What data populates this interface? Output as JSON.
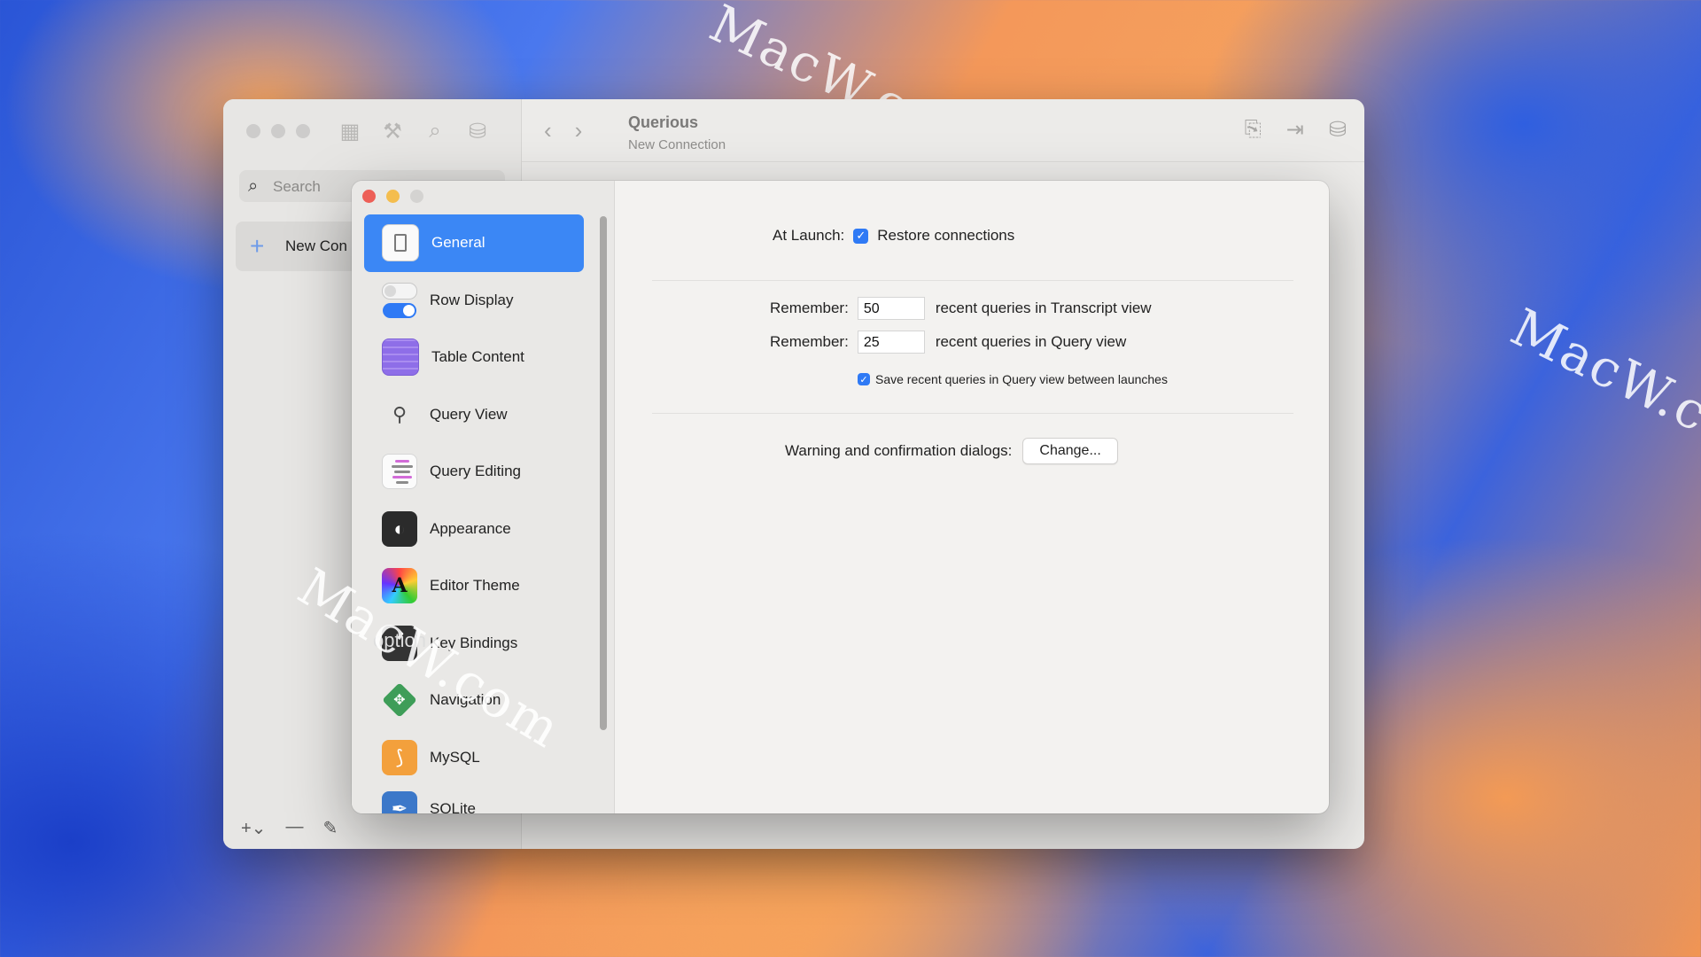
{
  "watermark": {
    "text": "MacW.com"
  },
  "main_window": {
    "title": "Querious",
    "subtitle": "New Connection",
    "search_placeholder": "Search",
    "sidebar_item_label": "New Con",
    "toolbar_icons": [
      "grid-icon",
      "wrench-icon",
      "search-icon",
      "database-icon"
    ],
    "right_icons": [
      "clipboard-export-icon",
      "export-icon",
      "database-export-icon"
    ]
  },
  "settings": {
    "sidebar": [
      {
        "label": "General",
        "icon": "general-switch-icon",
        "selected": true
      },
      {
        "label": "Row Display",
        "icon": "toggle-icon",
        "selected": false
      },
      {
        "label": "Table Content",
        "icon": "table-icon",
        "selected": false
      },
      {
        "label": "Query View",
        "icon": "magnifier-icon",
        "selected": false
      },
      {
        "label": "Query Editing",
        "icon": "code-lines-icon",
        "selected": false
      },
      {
        "label": "Appearance",
        "icon": "appearance-icon",
        "selected": false
      },
      {
        "label": "Editor Theme",
        "icon": "color-wheel-icon",
        "selected": false
      },
      {
        "label": "Key Bindings",
        "icon": "option-key-icon",
        "selected": false
      },
      {
        "label": "Navigation",
        "icon": "navigation-icon",
        "selected": false
      },
      {
        "label": "MySQL",
        "icon": "mysql-icon",
        "selected": false
      },
      {
        "label": "SQLite",
        "icon": "sqlite-icon",
        "selected": false
      }
    ],
    "keys_icon_text": "option",
    "general": {
      "at_launch_label": "At Launch:",
      "restore_connections_label": "Restore connections",
      "restore_connections_checked": true,
      "remember_label": "Remember:",
      "transcript_value": "50",
      "transcript_suffix": "recent queries in Transcript view",
      "queryview_value": "25",
      "queryview_suffix": "recent queries in Query view",
      "save_between_launches_label": "Save recent queries in Query view between launches",
      "save_between_launches_checked": true,
      "warnings_label": "Warning and confirmation dialogs:",
      "change_button_label": "Change..."
    }
  },
  "colors": {
    "accent": "#3b87f5",
    "close": "#ed5f57",
    "minimize": "#f4bd4e"
  }
}
